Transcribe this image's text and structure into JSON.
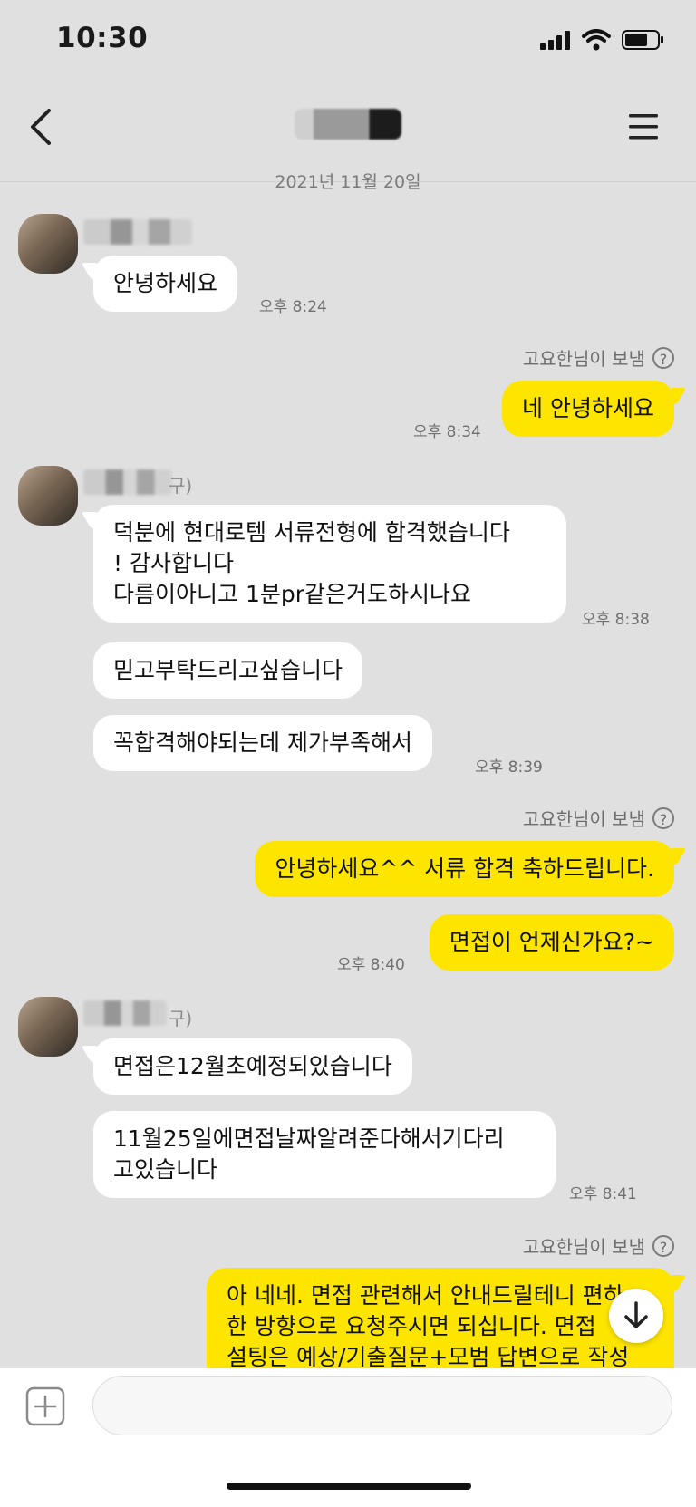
{
  "status_bar": {
    "time": "10:30"
  },
  "header": {
    "title_blurred": true
  },
  "date_divider": "2021년 11월 20일",
  "messages": [
    {
      "from": "other",
      "text": "안녕하세요",
      "time": "오후 8:24"
    },
    {
      "from": "me",
      "sent_by": "고요한님이 보냄",
      "text": "네 안녕하세요",
      "time": "오후 8:34"
    },
    {
      "from": "other",
      "name_suffix": "구)",
      "text": "덕분에 현대로템 서류전형에 합격했습니다\n! 감사합니다\n다름이아니고 1분pr같은거도하시나요",
      "time": "오후 8:38"
    },
    {
      "from": "other",
      "text": "믿고부탁드리고싶습니다"
    },
    {
      "from": "other",
      "text": "꼭합격해야되는데 제가부족해서",
      "time": "오후 8:39"
    },
    {
      "from": "me",
      "sent_by": "고요한님이 보냄",
      "text": "안녕하세요^^ 서류 합격 축하드립니다."
    },
    {
      "from": "me",
      "text": "면접이 언제신가요?~",
      "time": "오후 8:40"
    },
    {
      "from": "other",
      "name_suffix": "구)",
      "text": "면접은12월초예정되있습니다"
    },
    {
      "from": "other",
      "text": "11월25일에면접날짜알려준다해서기다리\n고있습니다",
      "time": "오후 8:41"
    },
    {
      "from": "me",
      "sent_by": "고요한님이 보냄",
      "text": "아 네네. 면접 관련해서 안내드릴테니 편하\n한 방향으로 요청주시면 되십니다. 면접\n설팅은 예상/기출질문+모범 답변으로 작성"
    }
  ],
  "input_bar": {
    "placeholder": ""
  },
  "icons": {
    "back": "chevron-left-icon",
    "menu": "hamburger-menu-icon",
    "help": "question-icon",
    "attach": "plus-icon",
    "scroll": "arrow-down-icon"
  },
  "colors": {
    "background": "#e0e0e0",
    "my_bubble": "#fee500",
    "other_bubble": "#ffffff"
  }
}
